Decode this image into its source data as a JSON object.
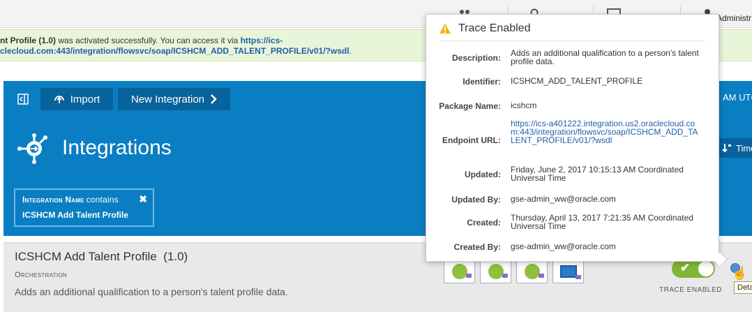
{
  "header": {
    "admin_label": "Administr"
  },
  "banner": {
    "text_strong": "nt Profile (1.0)",
    "text_rest": " was activated successfully. You can access it via ",
    "link_part1": "https://ics-",
    "link_part2": "clecloud.com:443/integration/flowsvc/soap/ICSHCM_ADD_TALENT_PROFILE/v01/?wsdl",
    "trailing": "."
  },
  "toolbar": {
    "import_label": "Import",
    "new_integration_label": "New Integration",
    "utc_text": "AM UTC"
  },
  "page": {
    "title": "Integrations",
    "time_button_label": "Time"
  },
  "filter": {
    "field_name": "Integration Name",
    "operator": "contains",
    "value": "ICSHCM Add Talent Profile",
    "close_glyph": "✖"
  },
  "integration": {
    "name": "ICSHCM Add Talent Profile",
    "version": "(1.0)",
    "type": "Orchestration",
    "description": "Adds an additional qualification to a person's talent profile data.",
    "trace_label": "TRACE ENABLED",
    "tooltip": "Deta"
  },
  "popover": {
    "title": "Trace Enabled",
    "warning_icon": "warning-triangle",
    "rows": [
      {
        "label": "Description:",
        "value": "Adds an additional qualification to a person's talent profile data."
      },
      {
        "label": "Identifier:",
        "value": "ICSHCM_ADD_TALENT_PROFILE"
      },
      {
        "label": "Package Name:",
        "value": "icshcm"
      },
      {
        "label": "Endpoint URL:",
        "value": "https://ics-a401222.integration.us2.oraclecloud.com:443/integration/flowsvc/soap/ICSHCM_ADD_TALENT_PROFILE/v01/?wsdl"
      },
      {
        "label": "Updated:",
        "value": "Friday, June 2, 2017 10:15:13 AM Coordinated Universal Time"
      },
      {
        "label": "Updated By:",
        "value": "gse-admin_ww@oracle.com"
      },
      {
        "label": "Created:",
        "value": "Thursday, April 13, 2017 7:21:35 AM Coordinated Universal Time"
      },
      {
        "label": "Created By:",
        "value": "gse-admin_ww@oracle.com"
      }
    ]
  },
  "colors": {
    "brand_blue": "#0a7ec2",
    "button_blue": "#08629b",
    "banner_green": "#e9f5d9",
    "toggle_green": "#7fb636",
    "link_blue": "#1f5fa8",
    "warning_yellow": "#f0b400"
  }
}
